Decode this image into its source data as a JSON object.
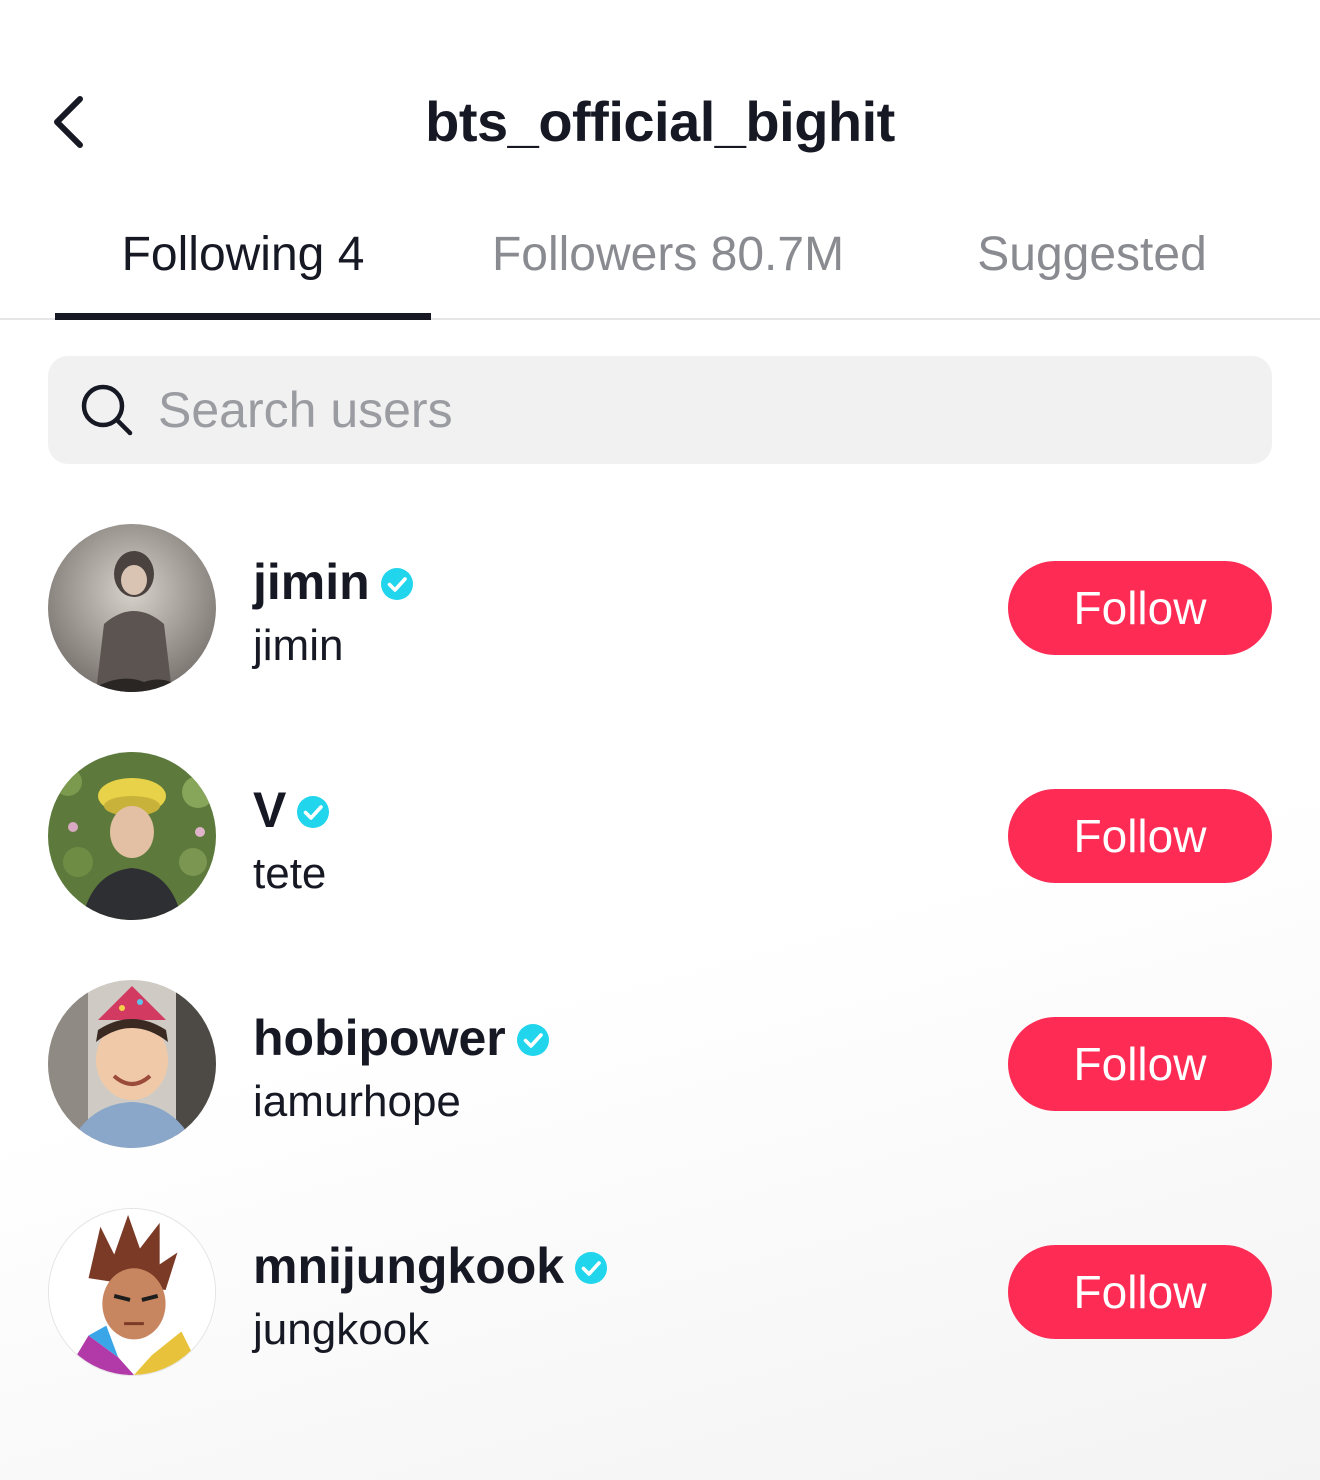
{
  "header": {
    "title": "bts_official_bighit"
  },
  "tabs": [
    {
      "label": "Following 4",
      "active": true
    },
    {
      "label": "Followers 80.7M",
      "active": false
    },
    {
      "label": "Suggested",
      "active": false
    }
  ],
  "search": {
    "placeholder": "Search users",
    "value": ""
  },
  "users": [
    {
      "display_name": "jimin",
      "username": "jimin",
      "verified": true,
      "button": "Follow"
    },
    {
      "display_name": "V",
      "username": "tete",
      "verified": true,
      "button": "Follow"
    },
    {
      "display_name": "hobipower",
      "username": "iamurhope",
      "verified": true,
      "button": "Follow"
    },
    {
      "display_name": "mnijungkook",
      "username": "jungkook",
      "verified": true,
      "button": "Follow"
    }
  ],
  "icons": {
    "back": "chevron-left-icon",
    "search": "search-icon",
    "verified": "verified-badge-icon"
  },
  "colors": {
    "follow_button": "#fe2c55",
    "verified_badge": "#20d5ec",
    "text_primary": "#161823",
    "text_secondary": "#8a8b91",
    "search_background": "#f1f1f2"
  }
}
